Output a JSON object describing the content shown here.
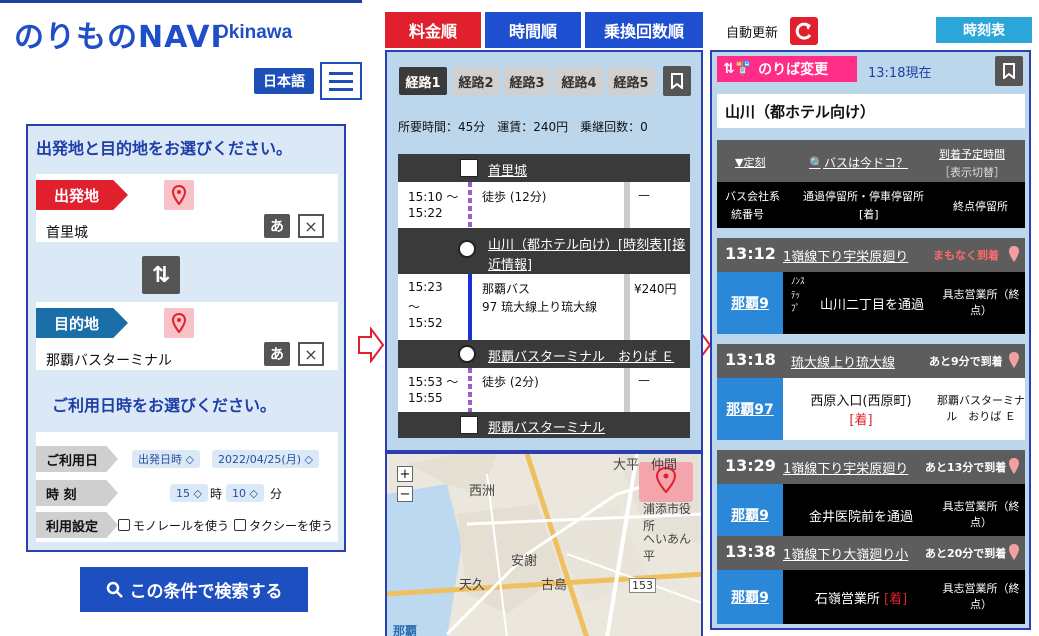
{
  "left": {
    "logo_main": "のりものNAVI",
    "logo_sub": "Okinawa",
    "lang_button": "日本語",
    "section_title": "出発地と目的地をお選びください。",
    "origin": {
      "label": "出発地",
      "value": "首里城"
    },
    "destination": {
      "label": "目的地",
      "value": "那覇バスターミナル"
    },
    "kana_button": "あ",
    "clear_button": "×",
    "date_title": "ご利用日時をお選びください。",
    "settings": {
      "date_label": "ご利用日",
      "date_type": "出発日時",
      "date_value": "2022/04/25(月)",
      "time_label": "時 刻",
      "hour_value": "15",
      "hour_unit": "時",
      "minute_value": "10",
      "minute_unit": "分",
      "setting_label": "利用設定",
      "option_monorail": "モノレールを使う",
      "option_taxi": "タクシーを使う"
    },
    "search_button": "この条件で検索する"
  },
  "middle": {
    "sort_tabs": [
      "料金順",
      "時間順",
      "乗換回数順"
    ],
    "route_tabs": [
      "経路1",
      "経路2",
      "経路3",
      "経路4",
      "経路5"
    ],
    "summary": "所要時間：45分　運賃：240円　乗継回数：0",
    "steps": {
      "start_stop": "首里城",
      "walk1_time_from": "15:10 〜",
      "walk1_time_to": "15:22",
      "walk1_desc": "徒歩 (12分)",
      "walk1_fare": "—",
      "stop1": "山川（都ホテル向け）",
      "stop1_link_timetable": "[時刻表]",
      "stop1_link_info_a": "[接",
      "stop1_link_info_b": "近情報]",
      "bus_time_from": "15:23",
      "bus_time_mid": "〜",
      "bus_time_to": "15:52",
      "bus_company": "那覇バス",
      "bus_route": "97 琉大線上り琉大線",
      "bus_fare": "¥240円",
      "stop2": "那覇バスターミナル　おりば Ｅ",
      "walk2_time_from": "15:53 〜",
      "walk2_time_to": "15:55",
      "walk2_desc": "徒歩 (2分)",
      "walk2_fare": "—",
      "end_stop": "那覇バスターミナル"
    },
    "map_labels": {
      "zoom_in": "+",
      "zoom_out": "−",
      "taihei": "大平",
      "nakama": "仲間",
      "urasoe": "浦添市役所",
      "nishisu": "西洲",
      "heian": "へいあん平",
      "aniya": "安謝",
      "tengu": "天久",
      "furujima": "古島",
      "route_153": "153",
      "naha": "那覇"
    }
  },
  "right": {
    "auto_update": "自動更新",
    "timetable_button": "時刻表",
    "change_badge": "のりば変更",
    "now_label": "13:18現在",
    "stop_name": "山川（都ホテル向け）",
    "controls": {
      "schedule": "▼定刻",
      "where_bus": "バスは今ドコ？",
      "arrival_a": "到着予定時間",
      "arrival_b": "［表示切替］"
    },
    "columns": {
      "company_a": "バス会社系",
      "company_b": "統番号",
      "via_a": "通過停留所・停車停留所",
      "via_b": "[着]",
      "dest": "終点停留所"
    },
    "buses": [
      {
        "time": "13:12",
        "line": "1嶺線下り宇栄原廻り",
        "status": "まもなく到着",
        "status_color": "#ff6a6a",
        "number": "那覇9",
        "via_small": "ﾉﾝｽﾃｯﾌﾟ",
        "via": "山川二丁目を通過",
        "via_mark": "",
        "dest": "具志営業所（終点）"
      },
      {
        "time": "13:18",
        "line": "琉大線上り琉大線",
        "status": "あと9分で到着",
        "status_color": "#ffffff",
        "number": "那覇97",
        "via_small": "",
        "via": "西原入口(西原町)",
        "via_mark": "[着]",
        "dest": "那覇バスターミナル　おりば Ｅ"
      },
      {
        "time": "13:29",
        "line": "1嶺線下り宇栄原廻り",
        "status": "あと13分で到着",
        "status_color": "#ffffff",
        "number": "那覇9",
        "via_small": "",
        "via": "金井医院前を通過",
        "via_mark": "",
        "dest": "具志営業所（終点）"
      },
      {
        "time": "13:38",
        "line": "1嶺線下り大嶺廻り小",
        "status": "あと20分で到着",
        "status_color": "#ffffff",
        "number": "那覇9",
        "via_small": "",
        "via": "石嶺営業所",
        "via_mark": "[着]",
        "dest": "具志営業所（終点）"
      }
    ]
  },
  "colors": {
    "accent_blue": "#1e4fb9",
    "red": "#e4322b",
    "pink": "#ff2d86",
    "panel_bg": "#bcd6ec"
  }
}
